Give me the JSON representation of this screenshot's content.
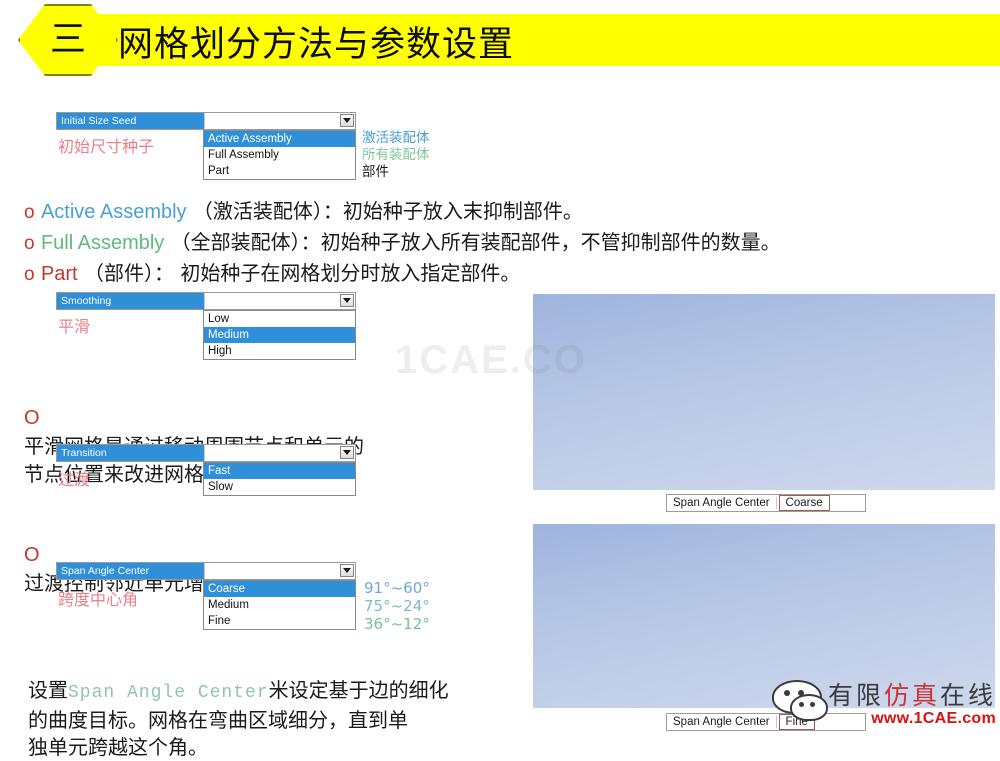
{
  "header": {
    "badge": "三",
    "title": "网格划分方法与参数设置"
  },
  "widgets": {
    "initial_size_seed": {
      "label": "Initial Size Seed",
      "value": "",
      "cn_label": "初始尺寸种子",
      "options": [
        "Active Assembly",
        "Full Assembly",
        "Part"
      ],
      "selected": "Active Assembly",
      "annotations": [
        "激活装配体",
        "所有装配体",
        "部件"
      ]
    },
    "smoothing": {
      "label": "Smoothing",
      "value": "",
      "cn_label": "平滑",
      "options": [
        "Low",
        "Medium",
        "High"
      ],
      "selected": "Medium"
    },
    "transition": {
      "label": "Transition",
      "value": "",
      "cn_label": "过渡",
      "options": [
        "Fast",
        "Slow"
      ],
      "selected": "Fast"
    },
    "span_angle_center": {
      "label": "Span Angle Center",
      "value": "",
      "cn_label": "跨度中心角",
      "options": [
        "Coarse",
        "Medium",
        "Fine"
      ],
      "selected": "Coarse",
      "angle_ranges": [
        "91°~60°",
        "75°~24°",
        "36°~12°"
      ]
    }
  },
  "bullets": [
    {
      "marker": "o",
      "en": "Active Assembly",
      "en_color": "blue",
      "cn": "（激活装配体）：初始种子放入末抑制部件。"
    },
    {
      "marker": "o",
      "en": "Full Assembly",
      "en_color": "green",
      "cn": "（全部装配体）：初始种子放入所有装配部件，不管抑制部件的数量。"
    },
    {
      "marker": "o",
      "en": "Part",
      "en_color": "dark",
      "cn": "（部件）： 初始种子在网格划分时放入指定部件。"
    }
  ],
  "paragraphs": {
    "smoothing_note": {
      "marker": "O",
      "text": "平滑网格是通过移动周围节点和单元的\n节点位置来改进网格质量。"
    },
    "transition_note": {
      "marker": "O",
      "text": "过渡控制邻近单元增长比."
    },
    "span_note": {
      "pre": "设置",
      "code": "Span Angle Center",
      "post": "米设定基于边的细化\n的曲度目标。网格在弯曲区域细分，直到单\n独单元跨越这个角。"
    }
  },
  "figures": [
    {
      "caption_key": "Span Angle Center",
      "caption_value": "Coarse"
    },
    {
      "caption_key": "Span Angle Center",
      "caption_value": "Fine"
    }
  ],
  "watermarks": {
    "center": "1CAE.CO",
    "brand_cn_prefix": "有限",
    "brand_cn_red": "仿真",
    "brand_cn_suffix": "在线",
    "brand_url": "www.1CAE.com"
  }
}
